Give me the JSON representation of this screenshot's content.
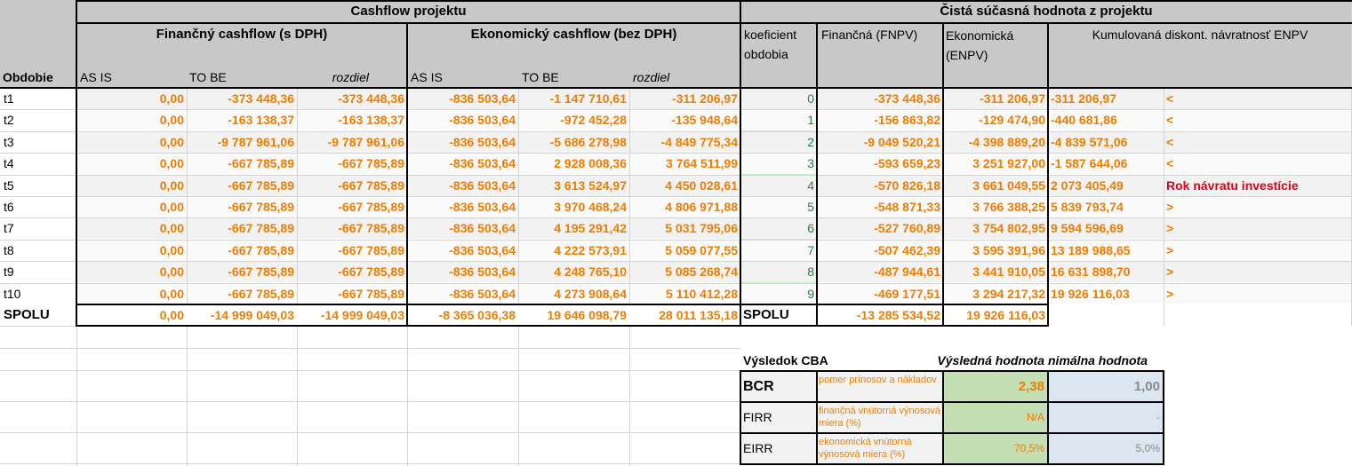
{
  "header": {
    "cashflow_title": "Cashflow projektu",
    "npv_title": "Čistá súčasná hodnota z projektu",
    "fin_cf_title": "Finančný cashflow (s DPH)",
    "eco_cf_title": "Ekonomický cashflow (bez DPH)",
    "coef_title": "koeficient obdobia",
    "fnpv_title": "Finančná (FNPV)",
    "enpv_title": "Ekonomická (ENPV)",
    "kum_title": "Kumulovaná diskont. návratnosť ENPV",
    "obdobie": "Obdobie",
    "as_is": "AS IS",
    "to_be": "TO BE",
    "rozdiel": "rozdiel"
  },
  "rows": [
    {
      "period": "t1",
      "fin_asis": "0,00",
      "fin_tobe": "-373 448,36",
      "fin_diff": "-373 448,36",
      "eco_asis": "-836 503,64",
      "eco_tobe": "-1 147 710,61",
      "eco_diff": "-311 206,97",
      "coef": "0",
      "fnpv": "-373 448,36",
      "enpv": "-311 206,97",
      "kum": "-311 206,97",
      "flag": "<"
    },
    {
      "period": "t2",
      "fin_asis": "0,00",
      "fin_tobe": "-163 138,37",
      "fin_diff": "-163 138,37",
      "eco_asis": "-836 503,64",
      "eco_tobe": "-972 452,28",
      "eco_diff": "-135 948,64",
      "coef": "1",
      "fnpv": "-156 863,82",
      "enpv": "-129 474,90",
      "kum": "-440 681,86",
      "flag": "<"
    },
    {
      "period": "t3",
      "fin_asis": "0,00",
      "fin_tobe": "-9 787 961,06",
      "fin_diff": "-9 787 961,06",
      "eco_asis": "-836 503,64",
      "eco_tobe": "-5 686 278,98",
      "eco_diff": "-4 849 775,34",
      "coef": "2",
      "fnpv": "-9 049 520,21",
      "enpv": "-4 398 889,20",
      "kum": "-4 839 571,06",
      "flag": "<"
    },
    {
      "period": "t4",
      "fin_asis": "0,00",
      "fin_tobe": "-667 785,89",
      "fin_diff": "-667 785,89",
      "eco_asis": "-836 503,64",
      "eco_tobe": "2 928 008,36",
      "eco_diff": "3 764 511,99",
      "coef": "3",
      "fnpv": "-593 659,23",
      "enpv": "3 251 927,00",
      "kum": "-1 587 644,06",
      "flag": "<"
    },
    {
      "period": "t5",
      "fin_asis": "0,00",
      "fin_tobe": "-667 785,89",
      "fin_diff": "-667 785,89",
      "eco_asis": "-836 503,64",
      "eco_tobe": "3 613 524,97",
      "eco_diff": "4 450 028,61",
      "coef": "4",
      "fnpv": "-570 826,18",
      "enpv": "3 661 049,55",
      "kum": "2 073 405,49",
      "flag": "Rok návratu investície"
    },
    {
      "period": "t6",
      "fin_asis": "0,00",
      "fin_tobe": "-667 785,89",
      "fin_diff": "-667 785,89",
      "eco_asis": "-836 503,64",
      "eco_tobe": "3 970 468,24",
      "eco_diff": "4 806 971,88",
      "coef": "5",
      "fnpv": "-548 871,33",
      "enpv": "3 766 388,25",
      "kum": "5 839 793,74",
      "flag": ">"
    },
    {
      "period": "t7",
      "fin_asis": "0,00",
      "fin_tobe": "-667 785,89",
      "fin_diff": "-667 785,89",
      "eco_asis": "-836 503,64",
      "eco_tobe": "4 195 291,42",
      "eco_diff": "5 031 795,06",
      "coef": "6",
      "fnpv": "-527 760,89",
      "enpv": "3 754 802,95",
      "kum": "9 594 596,69",
      "flag": ">"
    },
    {
      "period": "t8",
      "fin_asis": "0,00",
      "fin_tobe": "-667 785,89",
      "fin_diff": "-667 785,89",
      "eco_asis": "-836 503,64",
      "eco_tobe": "4 222 573,91",
      "eco_diff": "5 059 077,55",
      "coef": "7",
      "fnpv": "-507 462,39",
      "enpv": "3 595 391,96",
      "kum": "13 189 988,65",
      "flag": ">"
    },
    {
      "period": "t9",
      "fin_asis": "0,00",
      "fin_tobe": "-667 785,89",
      "fin_diff": "-667 785,89",
      "eco_asis": "-836 503,64",
      "eco_tobe": "4 248 765,10",
      "eco_diff": "5 085 268,74",
      "coef": "8",
      "fnpv": "-487 944,61",
      "enpv": "3 441 910,05",
      "kum": "16 631 898,70",
      "flag": ">"
    },
    {
      "period": "t10",
      "fin_asis": "0,00",
      "fin_tobe": "-667 785,89",
      "fin_diff": "-667 785,89",
      "eco_asis": "-836 503,64",
      "eco_tobe": "4 273 908,64",
      "eco_diff": "5 110 412,28",
      "coef": "9",
      "fnpv": "-469 177,51",
      "enpv": "3 294 217,32",
      "kum": "19 926 116,03",
      "flag": ">"
    }
  ],
  "totals": {
    "label": "SPOLU",
    "fin_asis": "0,00",
    "fin_tobe": "-14 999 049,03",
    "fin_diff": "-14 999 049,03",
    "eco_asis": "-8 365 036,38",
    "eco_tobe": "19 646 098,79",
    "eco_diff": "28 011 135,18",
    "npv_label": "SPOLU",
    "fnpv": "-13 285 534,52",
    "enpv": "19 926 116,03"
  },
  "cba": {
    "title": "Výsledok CBA",
    "result_header": "Výsledná hodnota",
    "min_header": "nimálna hodnota",
    "rows": [
      {
        "name": "BCR",
        "desc": "pomer prínosov a nákladov",
        "value": "2,38",
        "min": "1,00"
      },
      {
        "name": "FIRR",
        "desc": "finančná vnútorná výnosová miera (%)",
        "value": "N/A",
        "min": "-"
      },
      {
        "name": "EIRR",
        "desc": "ekonomická vnútorná výnosová miera (%)",
        "value": "70,5%",
        "min": "5,0%"
      }
    ]
  },
  "colors": {
    "orange": "#f07d00",
    "red": "#e0001a",
    "green": "#c6efce",
    "blue": "#dce6f1",
    "header_gray": "#c8c8c8"
  }
}
